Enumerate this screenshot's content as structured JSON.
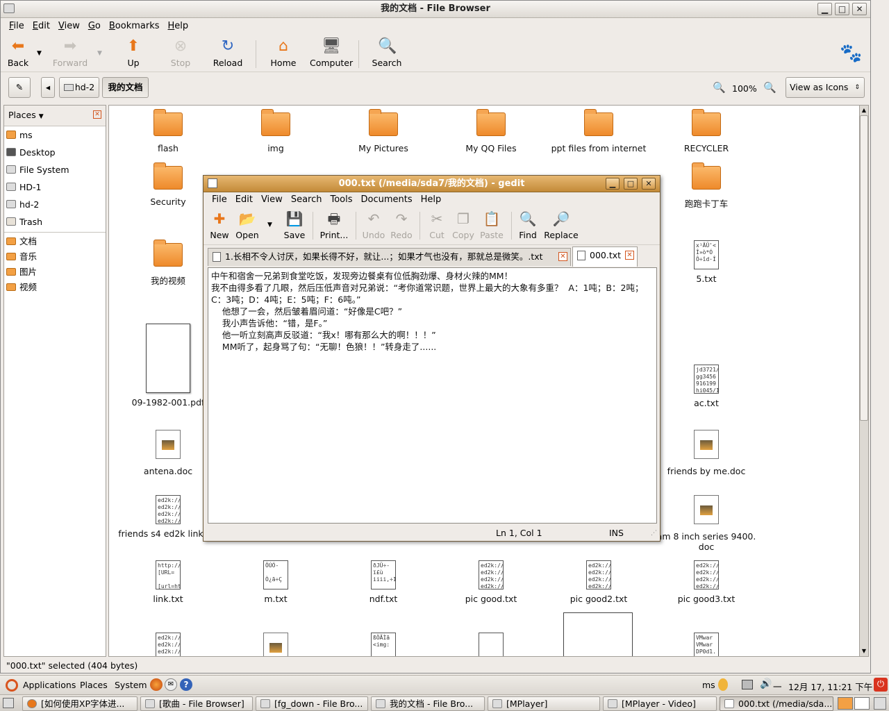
{
  "file_browser": {
    "title": "我的文档 - File Browser",
    "menu": [
      "File",
      "Edit",
      "View",
      "Go",
      "Bookmarks",
      "Help"
    ],
    "toolbar": {
      "back": "Back",
      "forward": "Forward",
      "up": "Up",
      "stop": "Stop",
      "reload": "Reload",
      "home": "Home",
      "computer": "Computer",
      "search": "Search"
    },
    "location": {
      "crumb1": "hd-2",
      "crumb2": "我的文档",
      "zoom": "100%",
      "view_mode": "View as Icons"
    },
    "sidebar": {
      "header": "Places",
      "items": [
        "ms",
        "Desktop",
        "File System",
        "HD-1",
        "hd-2",
        "Trash"
      ],
      "bookmarks": [
        "文档",
        "音乐",
        "图片",
        "视频"
      ]
    },
    "icons": {
      "flash": "flash",
      "img": "img",
      "my_pictures": "My Pictures",
      "my_qq_files": "My QQ Files",
      "ppt_files": "ppt files from internet",
      "recycler": "RECYCLER",
      "security": "Security",
      "paopao": "跑跑卡丁车",
      "my_video": "我的视频",
      "five_txt": "5.txt",
      "pdf": "09-1982-001.pdf",
      "ac_txt": "ac.txt",
      "antena": "antena.doc",
      "friends_me": "friends by me.doc",
      "friends_s4": "friends s4 ed2k link.txt",
      "am8_line1": "am 8 inch series 9400.",
      "am8_line2": "doc",
      "link_txt": "link.txt",
      "m_txt": "m.txt",
      "ndf_txt": "ndf.txt",
      "pic_good": "pic good.txt",
      "pic_good2": "pic good2.txt",
      "pic_good3": "pic good3.txt"
    },
    "thumb_text": {
      "five": "x¹ÄÜ'<\nÎ»ò*Ó\nÔ÷îd·Î",
      "ac": "jd3721/\ngg3456\n916199\nhi045/1",
      "ed2k": "ed2k://\ned2k://\ned2k://\ned2k://",
      "link": "http://\n[URL=\n\n[url=ht",
      "m": "ÔÚÓ-\n\nÒ¿ã÷Ç",
      "ndf": "ðJÜ÷-\nï£ù\niiii,÷1",
      "r6c3": "ßÖÃÌã\n<img:",
      "r6c6": "VMwar\nVMwar\nDP0d1."
    },
    "status": "\"000.txt\" selected (404 bytes)"
  },
  "gedit": {
    "title": "000.txt (/media/sda7/我的文档) - gedit",
    "menu": [
      "File",
      "Edit",
      "View",
      "Search",
      "Tools",
      "Documents",
      "Help"
    ],
    "toolbar": {
      "new": "New",
      "open": "Open",
      "save": "Save",
      "print": "Print...",
      "undo": "Undo",
      "redo": "Redo",
      "cut": "Cut",
      "copy": "Copy",
      "paste": "Paste",
      "find": "Find",
      "replace": "Replace"
    },
    "tabs": [
      "1.长相不令人讨厌，如果长得不好，就让...；如果才气也没有，那就总是微笑。.txt",
      "000.txt"
    ],
    "content": "中午和宿舍一兄弟到食堂吃饭，发现旁边餐桌有位低胸劲爆、身材火辣的MM！\n我不由得多看了几眼，然后压低声音对兄弟说：“考你道常识题，世界上最大的大象有多重？  A：1吨；B：2吨；C：3吨；D：4吨；E：5吨；F：6吨。”\n    他想了一会，然后皱着眉问道：“好像是C吧？”\n    我小声告诉他：“错，是F。”\n    他一听立刻高声反驳道：“我x！哪有那么大的啊！！！”\n    MM听了，起身骂了句：“无聊！色狼！！”转身走了......",
    "status_pos": "Ln 1, Col 1",
    "status_mode": "INS"
  },
  "panel": {
    "applications": "Applications",
    "places": "Places",
    "system": "System",
    "user": "ms",
    "clock": "12月 17, 11:21 下午",
    "keyboard": "一"
  },
  "taskbar": [
    "[如何使用XP字体进...",
    "[歌曲 - File Browser]",
    "[fg_down - File Bro...",
    "我的文档 - File Bro...",
    "[MPlayer]",
    "[MPlayer - Video]",
    "000.txt (/media/sda..."
  ]
}
